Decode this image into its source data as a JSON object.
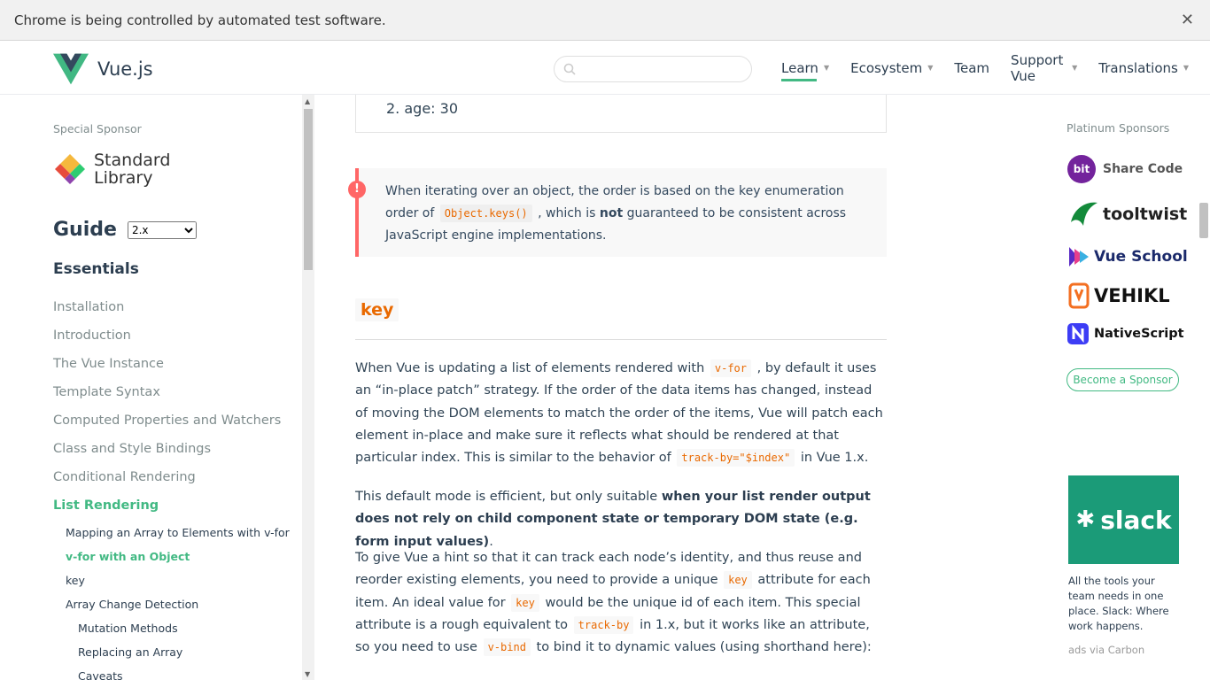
{
  "automation_bar": {
    "message": "Chrome is being controlled by automated test software.",
    "close": "✕"
  },
  "header": {
    "brand": "Vue.js",
    "search": {
      "placeholder": ""
    },
    "nav": [
      {
        "label": "Learn",
        "caret": true,
        "active": true
      },
      {
        "label": "Ecosystem",
        "caret": true
      },
      {
        "label": "Team",
        "caret": false
      },
      {
        "label": "Support Vue",
        "caret": true
      },
      {
        "label": "Translations",
        "caret": true
      }
    ]
  },
  "sidebar": {
    "special_sponsor_label": "Special Sponsor",
    "sponsor_line1": "Standard",
    "sponsor_line2": "Library",
    "guide_title": "Guide",
    "version": "2.x",
    "section": "Essentials",
    "items": [
      {
        "label": "Installation"
      },
      {
        "label": "Introduction"
      },
      {
        "label": "The Vue Instance"
      },
      {
        "label": "Template Syntax"
      },
      {
        "label": "Computed Properties and Watchers"
      },
      {
        "label": "Class and Style Bindings"
      },
      {
        "label": "Conditional Rendering"
      },
      {
        "label": "List Rendering"
      }
    ],
    "subitems": [
      {
        "label": "Mapping an Array to Elements with v-for"
      },
      {
        "label": "v-for with an Object"
      },
      {
        "label": "key"
      },
      {
        "label": "Array Change Detection"
      }
    ],
    "subsubitems": [
      {
        "label": "Mutation Methods"
      },
      {
        "label": "Replacing an Array"
      },
      {
        "label": "Caveats"
      }
    ]
  },
  "content": {
    "list_item": "2. age: 30",
    "tip": {
      "t1": "When iterating over an object, the order is based on the key enumeration order of",
      "code": "Object.keys()",
      "t2": ", which is",
      "bold": "not",
      "t3": "guaranteed to be consistent across JavaScript engine implementations."
    },
    "heading": "key",
    "p1": {
      "t1": "When Vue is updating a list of elements rendered with",
      "c1": "v-for",
      "t2": ", by default it uses an “in-place patch” strategy. If the order of the data items has changed, instead of moving the DOM elements to match the order of the items, Vue will patch each element in-place and make sure it reflects what should be rendered at that particular index. This is similar to the behavior of",
      "c2": "track-by=\"$index\"",
      "t3": "in Vue 1.x."
    },
    "p2": {
      "t1": "This default mode is efficient, but only suitable",
      "bold": "when your list render output does not rely on child component state or temporary DOM state (e.g. form input values)",
      "t2": "."
    },
    "p3": {
      "t1": "To give Vue a hint so that it can track each node’s identity, and thus reuse and reorder existing elements, you need to provide a unique",
      "c1": "key",
      "t2": "attribute for each item. An ideal value for",
      "c2": "key",
      "t3": "would be the unique id of each item. This special attribute is a rough equivalent to",
      "c3": "track-by",
      "t4": "in 1.x, but it works like an attribute, so you need to use",
      "c4": "v-bind",
      "t5": "to bind it to dynamic values (using shorthand here):"
    }
  },
  "right": {
    "platinum_label": "Platinum Sponsors",
    "sponsors": [
      {
        "badge": "bit",
        "name": "Share Code"
      },
      {
        "name": "tooltwist"
      },
      {
        "name": "Vue School"
      },
      {
        "name": "VEHIKL"
      },
      {
        "name": "NativeScript"
      }
    ],
    "become_label": "Become a Sponsor",
    "carbon_brand": "slack",
    "carbon_text": "All the tools your team needs in one place. Slack: Where work happens.",
    "carbon_via": "ads via Carbon"
  },
  "colors": {
    "accent": "#42b983",
    "warning": "#ff6666",
    "code": "#e96900"
  }
}
